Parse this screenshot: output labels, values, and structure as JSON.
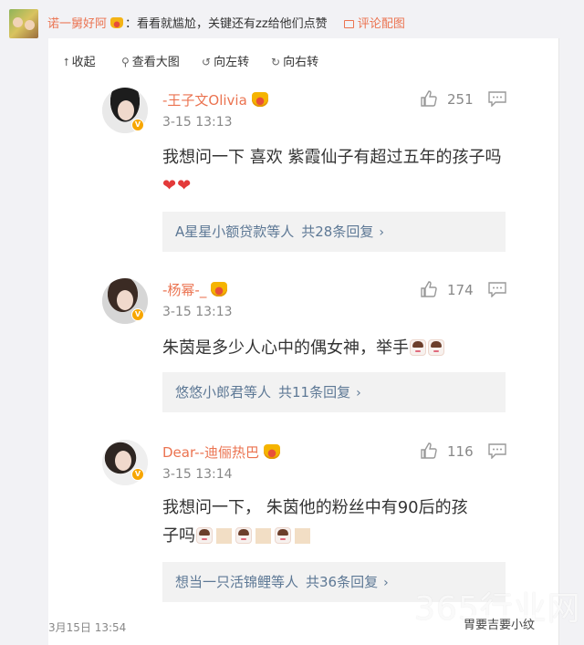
{
  "post": {
    "author": "诺一舅好阿",
    "comment": "：看看就尴尬，关键还有zz给他们点赞",
    "action_link": "评论配图"
  },
  "toolbar": {
    "collapse": "收起",
    "view_large": "查看大图",
    "rotate_left": "向左转",
    "rotate_right": "向右转"
  },
  "comments": [
    {
      "name": "-王子文Olivia",
      "time": "3-15 13:13",
      "likes": "251",
      "text": "我想问一下 喜欢 紫霞仙子有超过五年的孩子吗",
      "reply_users": "A星星小额贷款等人",
      "reply_count": "共28条回复"
    },
    {
      "name": "-杨幂-_",
      "time": "3-15 13:13",
      "likes": "174",
      "text": "朱茵是多少人心中的偶女神，举手",
      "reply_users": "悠悠小郎君等人",
      "reply_count": "共11条回复"
    },
    {
      "name": "Dear--迪俪热巴",
      "time": "3-15 13:14",
      "likes": "116",
      "text_line1": "我想问一下，  朱茵他的粉丝中有90后的孩",
      "text_line2": "子吗",
      "reply_users": "想当一只活锦鲤等人",
      "reply_count": "共36条回复"
    }
  ],
  "footer": {
    "time": "3月15日 13:54"
  },
  "watermark": {
    "big": "365行业网",
    "small": "胃要吉要小纹",
    "sub": "3·3"
  },
  "colors": {
    "accent": "#eb7350",
    "link": "#5d7895",
    "reply_bg": "#f2f2f2"
  }
}
